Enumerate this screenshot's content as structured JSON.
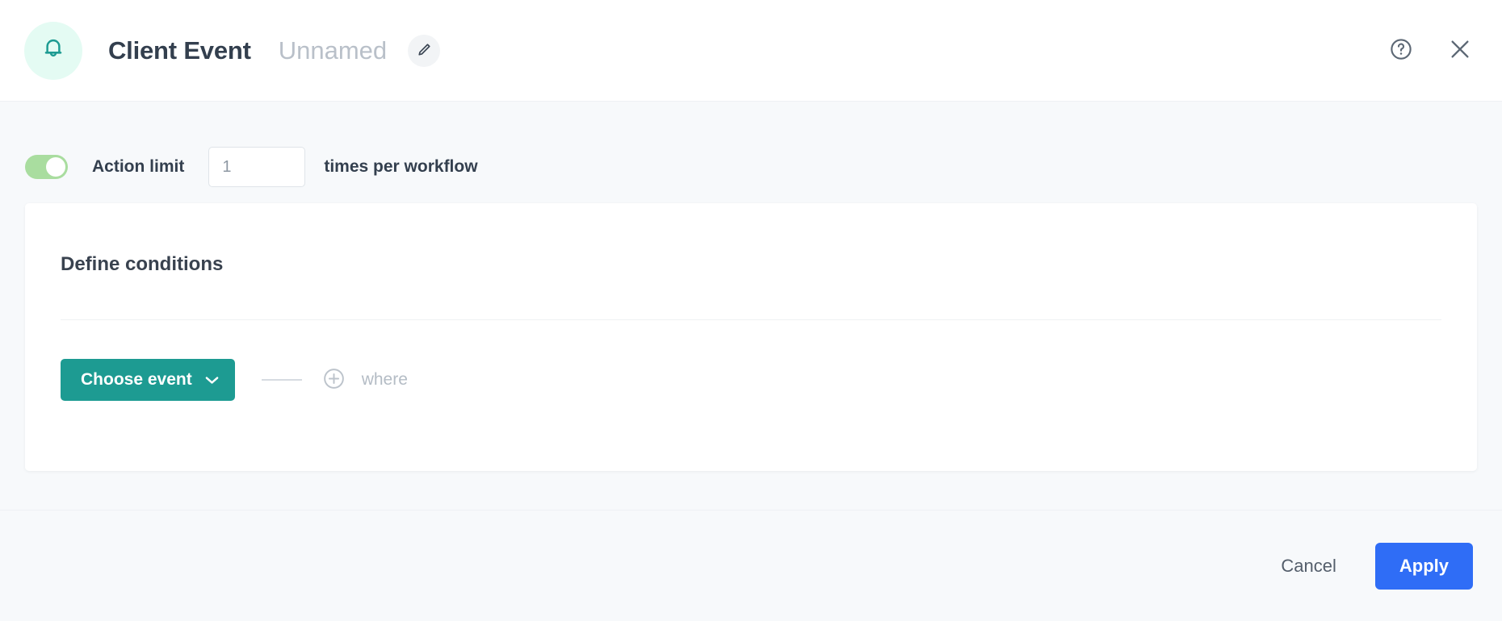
{
  "header": {
    "icon": "bell-icon",
    "title": "Client Event",
    "subtitle": "Unnamed",
    "edit_icon": "pencil-icon",
    "help_icon": "help-circle-icon",
    "close_icon": "close-icon",
    "icon_color": "#1d9b92",
    "icon_bg": "#e4fbf3"
  },
  "action_limit": {
    "toggle_on": true,
    "toggle_color": "#a9dd9f",
    "label": "Action limit",
    "value": "1",
    "placeholder": "1",
    "suffix": "times per workflow"
  },
  "conditions": {
    "heading": "Define conditions",
    "choose_event_label": "Choose event",
    "choose_event_color": "#1d9b92",
    "chevron_icon": "chevron-down-icon",
    "add_icon": "plus-circle-icon",
    "where_label": "where"
  },
  "footer": {
    "cancel_label": "Cancel",
    "apply_label": "Apply",
    "apply_color": "#2f6df6"
  }
}
